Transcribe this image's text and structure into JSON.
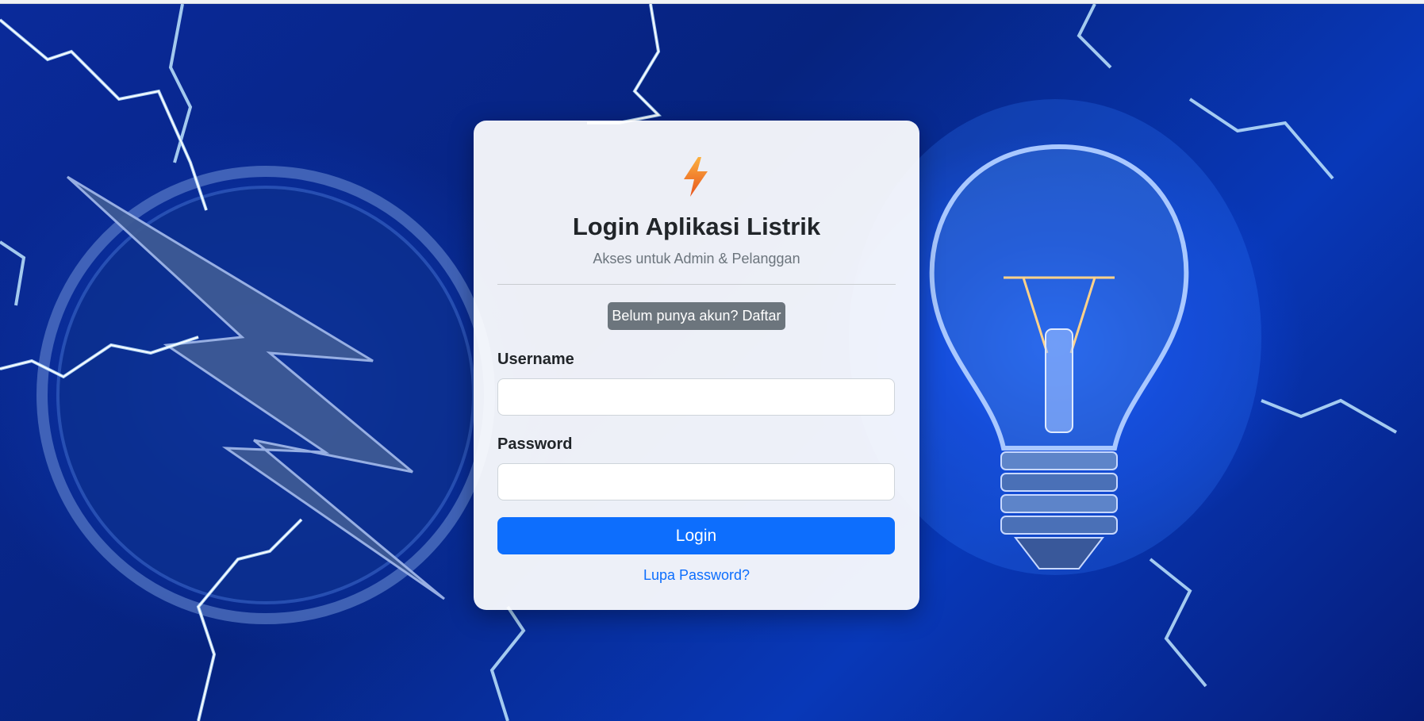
{
  "login_card": {
    "icon": "lightning-bolt-icon",
    "title": "Login Aplikasi Listrik",
    "subtitle": "Akses untuk Admin & Pelanggan",
    "register_button": "Belum punya akun? Daftar",
    "username_label": "Username",
    "username_value": "",
    "password_label": "Password",
    "password_value": "",
    "login_button": "Login",
    "forgot_link": "Lupa Password?"
  },
  "background": {
    "description_icons": [
      "lightning-emblem-icon",
      "light-bulb-icon"
    ]
  },
  "colors": {
    "primary": "#0d6efd",
    "secondary": "#6c757d",
    "bolt_orange": "#f4862a"
  }
}
